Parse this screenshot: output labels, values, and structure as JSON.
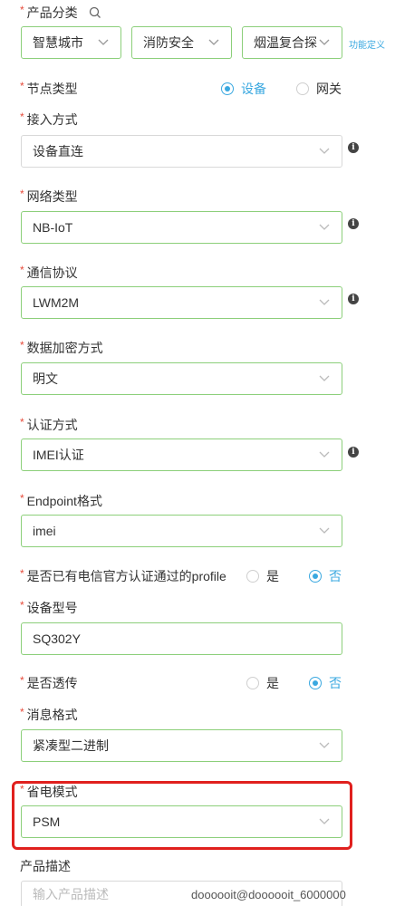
{
  "category": {
    "label": "产品分类",
    "search_icon": "search-icon",
    "selects": [
      "智慧城市",
      "消防安全",
      "烟温复合探"
    ],
    "function_link": "功能定义"
  },
  "node_type": {
    "label": "节点类型",
    "options": [
      "设备",
      "网关"
    ],
    "selected": "设备"
  },
  "access_mode": {
    "label": "接入方式",
    "value": "设备直连"
  },
  "network_type": {
    "label": "网络类型",
    "value": "NB-IoT"
  },
  "protocol": {
    "label": "通信协议",
    "value": "LWM2M"
  },
  "encryption": {
    "label": "数据加密方式",
    "value": "明文"
  },
  "auth_mode": {
    "label": "认证方式",
    "value": "IMEI认证"
  },
  "endpoint_format": {
    "label": "Endpoint格式",
    "value": "imei"
  },
  "profile": {
    "label": "是否已有电信官方认证通过的profile",
    "options": [
      "是",
      "否"
    ],
    "selected": "否"
  },
  "model": {
    "label": "设备型号",
    "value": "SQ302Y"
  },
  "passthrough": {
    "label": "是否透传",
    "options": [
      "是",
      "否"
    ],
    "selected": "否"
  },
  "message_format": {
    "label": "消息格式",
    "value": "紧凑型二进制"
  },
  "power_mode": {
    "label": "省电模式",
    "value": "PSM"
  },
  "description": {
    "label": "产品描述",
    "placeholder": "输入产品描述"
  },
  "watermark": "doooooit@doooooit_6000000",
  "colors": {
    "accent": "#3aa8e0",
    "border_green": "#8ccf7a",
    "required": "#e74c3c",
    "highlight": "#e0201e"
  }
}
